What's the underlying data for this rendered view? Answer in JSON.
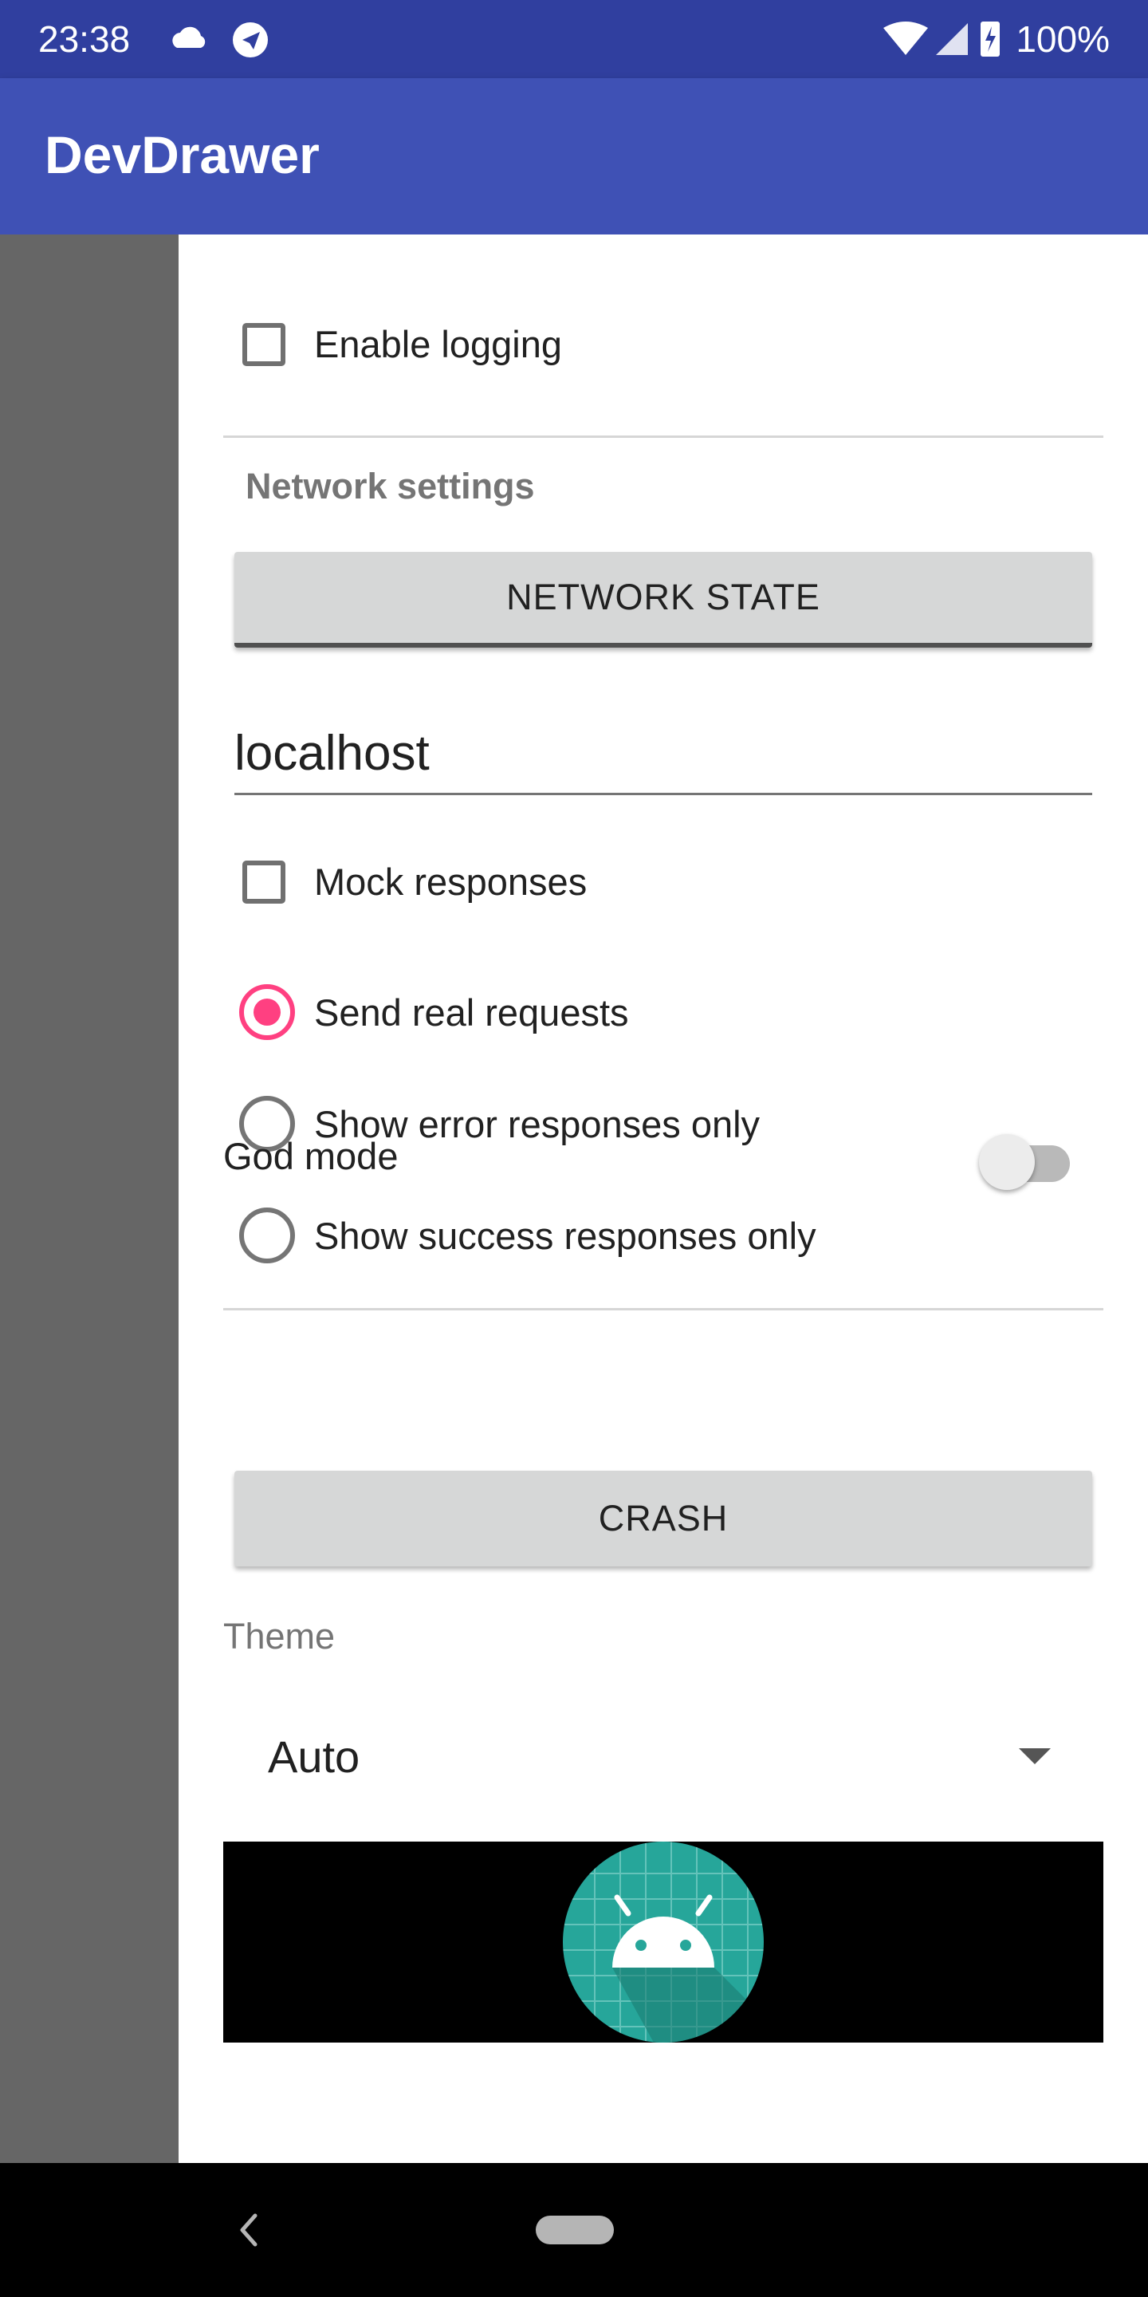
{
  "status_bar": {
    "time": "23:38",
    "battery": "100%",
    "icons": [
      "cloud-icon",
      "telegram-icon",
      "wifi-icon",
      "signal-icon",
      "battery-charging-icon"
    ]
  },
  "app_bar": {
    "title": "DevDrawer"
  },
  "drawer": {
    "enable_logging": {
      "label": "Enable logging",
      "checked": false
    },
    "network_section": {
      "title": "Network settings",
      "network_state_button": "NETWORK STATE",
      "host_field_value": "localhost",
      "mock_responses": {
        "label": "Mock responses",
        "checked": false
      },
      "radio_options": [
        {
          "label": "Send real requests",
          "selected": true
        },
        {
          "label": "Show error responses only",
          "selected": false
        },
        {
          "label": "Show success responses only",
          "selected": false
        }
      ]
    },
    "god_mode": {
      "label": "God mode",
      "enabled": false
    },
    "crash_button": "CRASH",
    "theme": {
      "label": "Theme",
      "selected": "Auto"
    },
    "banner_icon": "android-launcher-icon"
  },
  "navigation_bar": {
    "icons": [
      "back-icon",
      "home-pill"
    ]
  },
  "colors": {
    "status_bar": "#303F9F",
    "app_bar": "#3F51B5",
    "accent": "#FF4081",
    "scrim": "#666666"
  }
}
